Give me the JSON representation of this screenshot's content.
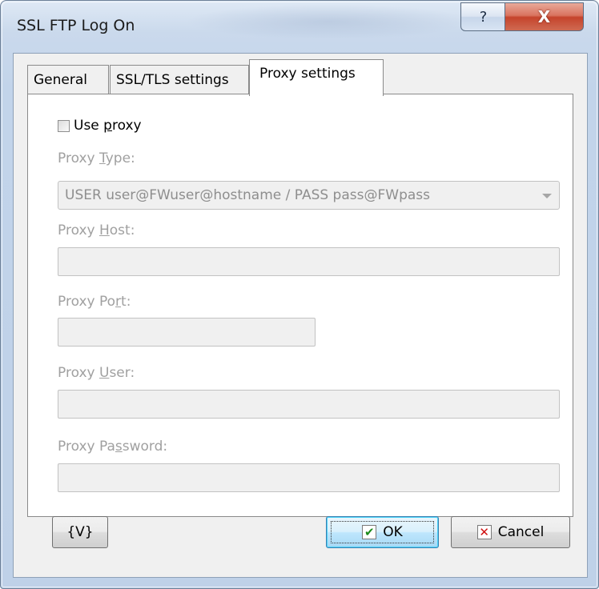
{
  "window": {
    "title": "SSL FTP Log On",
    "help_glyph": "?",
    "close_glyph": "X"
  },
  "tabs": [
    {
      "label": "General",
      "selected": false
    },
    {
      "label": "SSL/TLS settings",
      "selected": false
    },
    {
      "label": "Proxy settings",
      "selected": true
    }
  ],
  "proxy": {
    "use_proxy": {
      "label_before": "Use ",
      "label_underlined": "p",
      "label_after": "roxy",
      "checked": false
    },
    "type_label": {
      "before": "Proxy ",
      "underlined": "T",
      "after": "ype:"
    },
    "type_value": "USER user@FWuser@hostname / PASS pass@FWpass",
    "host_label": {
      "before": "Proxy ",
      "underlined": "H",
      "after": "ost:"
    },
    "host_value": "",
    "port_label": {
      "before": "Proxy Po",
      "underlined": "r",
      "after": "t:"
    },
    "port_value": "",
    "user_label": {
      "before": "Proxy ",
      "underlined": "U",
      "after": "ser:"
    },
    "user_value": "",
    "password_label": {
      "before": "Proxy Pa",
      "underlined": "s",
      "after": "sword:"
    },
    "password_value": ""
  },
  "buttons": {
    "variables_label": "{V}",
    "ok_label": "OK",
    "ok_icon_glyph": "✔",
    "cancel_label": "Cancel",
    "cancel_icon_glyph": "✕"
  },
  "colors": {
    "disabled_text": "#a0a0a0",
    "ok_icon": "#1a8a1a",
    "cancel_icon": "#d01010",
    "close_button": "#c5442c"
  }
}
